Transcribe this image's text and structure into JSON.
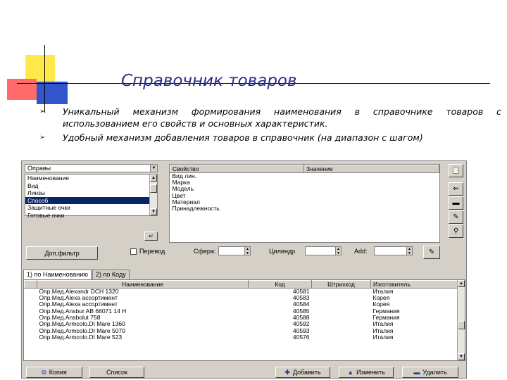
{
  "slide": {
    "title": "Справочник товаров",
    "bullets": [
      "Уникальный механизм формирования наименования в справочнике товаров с использованием его свойств и основных характеристик.",
      "Удобный механизм добавления товаров в справочник (на диапазон с шагом)"
    ],
    "bullet_icon": "arrow-bullet-icon"
  },
  "app": {
    "category_combo": "Оправы",
    "attributes": [
      "Наименование",
      "Вид",
      "Линзы",
      "Способ",
      "Защитные очки",
      "Готовые очки"
    ],
    "attributes_selected_index": 3,
    "properties_headers": [
      "Свойство",
      "Значение"
    ],
    "properties": [
      "Вид лин.",
      "Марка",
      "Модель",
      "Цвет",
      "Материал",
      "Принадлежность"
    ],
    "filter_button": "Доп.фильтр",
    "filters": {
      "reverse_label": "Перевод",
      "sphere_label": "Сфера:",
      "cylinder_label": "Цилиндр",
      "add_label": "Add:"
    },
    "tabs": [
      "1) по Наименованию",
      "2) по Коду"
    ],
    "grid": {
      "headers": [
        "Наименование",
        "Код",
        "Штрихкод",
        "Изготовитель"
      ],
      "rows": [
        [
          "Опр.Мед.Alexandr DCH 1320",
          "40581",
          "",
          "Италия"
        ],
        [
          "Опр.Мед.Alexa ассортимент",
          "40583",
          "",
          "Корея"
        ],
        [
          "Опр.Мед.Alexa ассортимент",
          "40584",
          "",
          "Корея"
        ],
        [
          "Опр.Мед.Ansbur AB 66071 14 H",
          "40585",
          "",
          "Германия"
        ],
        [
          "Опр.Мед.Ansbolut 758",
          "40588",
          "",
          "Германия"
        ],
        [
          "Опр.Мед.Armcolo.DI Mare 1360",
          "40592",
          "",
          "Италия"
        ],
        [
          "Опр.Мед.Armcolo.DI Mare 5070",
          "40593",
          "",
          "Италия"
        ],
        [
          "Опр.Мед.Armcolo.DI Mare 523",
          "40576",
          "",
          "Италия"
        ]
      ]
    },
    "footer": {
      "copy": "Копия",
      "list": "Список",
      "add": "Добавить",
      "edit": "Изменить",
      "delete": "Удалить"
    }
  }
}
